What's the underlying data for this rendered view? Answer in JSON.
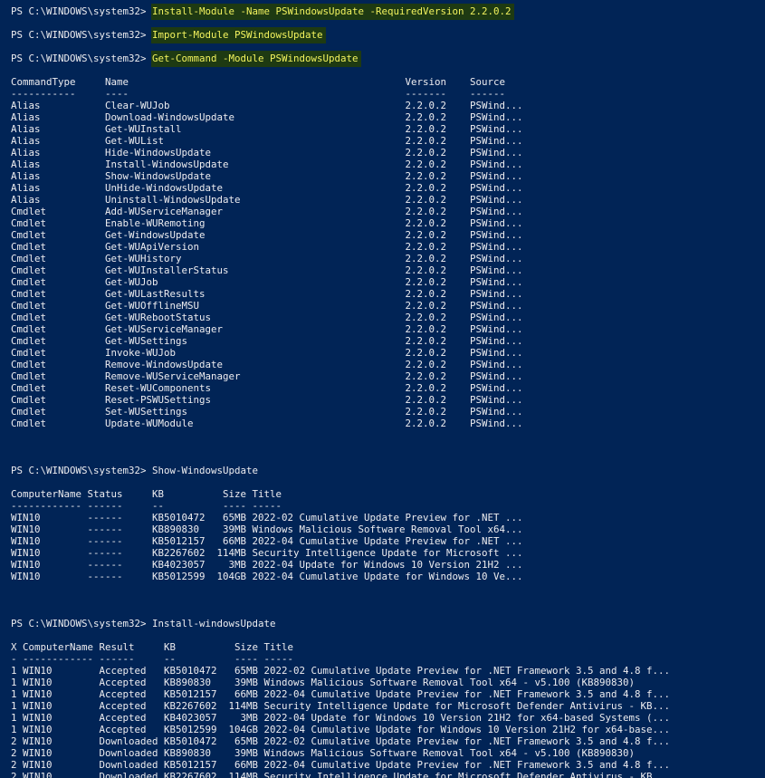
{
  "prompt": "PS C:\\WINDOWS\\system32> ",
  "blocks": [
    {
      "kind": "prompt",
      "cmd": "Install-Module -Name PSWindowsUpdate -RequiredVersion 2.2.0.2",
      "hl": true
    },
    {
      "kind": "gap"
    },
    {
      "kind": "prompt",
      "cmd": "Import-Module PSWindowsUpdate",
      "hl": true
    },
    {
      "kind": "gap"
    },
    {
      "kind": "prompt",
      "cmd": "Get-Command -Module PSWindowsUpdate",
      "hl": true
    },
    {
      "kind": "gap"
    },
    {
      "kind": "text",
      "text": "CommandType     Name                                               Version    Source"
    },
    {
      "kind": "text",
      "text": "-----------     ----                                               -------    ------"
    },
    {
      "kind": "text",
      "text": "Alias           Clear-WUJob                                        2.2.0.2    PSWind..."
    },
    {
      "kind": "text",
      "text": "Alias           Download-WindowsUpdate                             2.2.0.2    PSWind..."
    },
    {
      "kind": "text",
      "text": "Alias           Get-WUInstall                                      2.2.0.2    PSWind..."
    },
    {
      "kind": "text",
      "text": "Alias           Get-WUList                                         2.2.0.2    PSWind..."
    },
    {
      "kind": "text",
      "text": "Alias           Hide-WindowsUpdate                                 2.2.0.2    PSWind..."
    },
    {
      "kind": "text",
      "text": "Alias           Install-WindowsUpdate                              2.2.0.2    PSWind..."
    },
    {
      "kind": "text",
      "text": "Alias           Show-WindowsUpdate                                 2.2.0.2    PSWind..."
    },
    {
      "kind": "text",
      "text": "Alias           UnHide-WindowsUpdate                               2.2.0.2    PSWind..."
    },
    {
      "kind": "text",
      "text": "Alias           Uninstall-WindowsUpdate                            2.2.0.2    PSWind..."
    },
    {
      "kind": "text",
      "text": "Cmdlet          Add-WUServiceManager                               2.2.0.2    PSWind..."
    },
    {
      "kind": "text",
      "text": "Cmdlet          Enable-WURemoting                                  2.2.0.2    PSWind..."
    },
    {
      "kind": "text",
      "text": "Cmdlet          Get-WindowsUpdate                                  2.2.0.2    PSWind..."
    },
    {
      "kind": "text",
      "text": "Cmdlet          Get-WUApiVersion                                   2.2.0.2    PSWind..."
    },
    {
      "kind": "text",
      "text": "Cmdlet          Get-WUHistory                                      2.2.0.2    PSWind..."
    },
    {
      "kind": "text",
      "text": "Cmdlet          Get-WUInstallerStatus                              2.2.0.2    PSWind..."
    },
    {
      "kind": "text",
      "text": "Cmdlet          Get-WUJob                                          2.2.0.2    PSWind..."
    },
    {
      "kind": "text",
      "text": "Cmdlet          Get-WULastResults                                  2.2.0.2    PSWind..."
    },
    {
      "kind": "text",
      "text": "Cmdlet          Get-WUOfflineMSU                                   2.2.0.2    PSWind..."
    },
    {
      "kind": "text",
      "text": "Cmdlet          Get-WURebootStatus                                 2.2.0.2    PSWind..."
    },
    {
      "kind": "text",
      "text": "Cmdlet          Get-WUServiceManager                               2.2.0.2    PSWind..."
    },
    {
      "kind": "text",
      "text": "Cmdlet          Get-WUSettings                                     2.2.0.2    PSWind..."
    },
    {
      "kind": "text",
      "text": "Cmdlet          Invoke-WUJob                                       2.2.0.2    PSWind..."
    },
    {
      "kind": "text",
      "text": "Cmdlet          Remove-WindowsUpdate                               2.2.0.2    PSWind..."
    },
    {
      "kind": "text",
      "text": "Cmdlet          Remove-WUServiceManager                            2.2.0.2    PSWind..."
    },
    {
      "kind": "text",
      "text": "Cmdlet          Reset-WUComponents                                 2.2.0.2    PSWind..."
    },
    {
      "kind": "text",
      "text": "Cmdlet          Reset-PSWUSettings                                 2.2.0.2    PSWind..."
    },
    {
      "kind": "text",
      "text": "Cmdlet          Set-WUSettings                                     2.2.0.2    PSWind..."
    },
    {
      "kind": "text",
      "text": "Cmdlet          Update-WUModule                                    2.2.0.2    PSWind..."
    },
    {
      "kind": "gap"
    },
    {
      "kind": "gap"
    },
    {
      "kind": "gap"
    },
    {
      "kind": "prompt",
      "cmd": "Show-WindowsUpdate",
      "hl": false
    },
    {
      "kind": "gap"
    },
    {
      "kind": "text",
      "text": "ComputerName Status     KB          Size Title"
    },
    {
      "kind": "text",
      "text": "------------ ------     --          ---- -----"
    },
    {
      "kind": "text",
      "text": "WIN10        ------     KB5010472   65MB 2022-02 Cumulative Update Preview for .NET ..."
    },
    {
      "kind": "text",
      "text": "WIN10        ------     KB890830    39MB Windows Malicious Software Removal Tool x64..."
    },
    {
      "kind": "text",
      "text": "WIN10        ------     KB5012157   66MB 2022-04 Cumulative Update Preview for .NET ..."
    },
    {
      "kind": "text",
      "text": "WIN10        ------     KB2267602  114MB Security Intelligence Update for Microsoft ..."
    },
    {
      "kind": "text",
      "text": "WIN10        ------     KB4023057    3MB 2022-04 Update for Windows 10 Version 21H2 ..."
    },
    {
      "kind": "text",
      "text": "WIN10        ------     KB5012599  104GB 2022-04 Cumulative Update for Windows 10 Ve..."
    },
    {
      "kind": "gap"
    },
    {
      "kind": "gap"
    },
    {
      "kind": "gap"
    },
    {
      "kind": "prompt",
      "cmd": "Install-windowsUpdate",
      "hl": false
    },
    {
      "kind": "gap"
    },
    {
      "kind": "text",
      "text": "X ComputerName Result     KB          Size Title"
    },
    {
      "kind": "text",
      "text": "- ------------ ------     --          ---- -----"
    },
    {
      "kind": "text",
      "text": "1 WIN10        Accepted   KB5010472   65MB 2022-02 Cumulative Update Preview for .NET Framework 3.5 and 4.8 f..."
    },
    {
      "kind": "text",
      "text": "1 WIN10        Accepted   KB890830    39MB Windows Malicious Software Removal Tool x64 - v5.100 (KB890830)"
    },
    {
      "kind": "text",
      "text": "1 WIN10        Accepted   KB5012157   66MB 2022-04 Cumulative Update Preview for .NET Framework 3.5 and 4.8 f..."
    },
    {
      "kind": "text",
      "text": "1 WIN10        Accepted   KB2267602  114MB Security Intelligence Update for Microsoft Defender Antivirus - KB..."
    },
    {
      "kind": "text",
      "text": "1 WIN10        Accepted   KB4023057    3MB 2022-04 Update for Windows 10 Version 21H2 for x64-based Systems (..."
    },
    {
      "kind": "text",
      "text": "1 WIN10        Accepted   KB5012599  104GB 2022-04 Cumulative Update for Windows 10 Version 21H2 for x64-base..."
    },
    {
      "kind": "text",
      "text": "2 WIN10        Downloaded KB5010472   65MB 2022-02 Cumulative Update Preview for .NET Framework 3.5 and 4.8 f..."
    },
    {
      "kind": "text",
      "text": "2 WIN10        Downloaded KB890830    39MB Windows Malicious Software Removal Tool x64 - v5.100 (KB890830)"
    },
    {
      "kind": "text",
      "text": "2 WIN10        Downloaded KB5012157   66MB 2022-04 Cumulative Update Preview for .NET Framework 3.5 and 4.8 f..."
    },
    {
      "kind": "text",
      "text": "2 WIN10        Downloaded KB2267602  114MB Security Intelligence Update for Microsoft Defender Antivirus - KB..."
    }
  ]
}
